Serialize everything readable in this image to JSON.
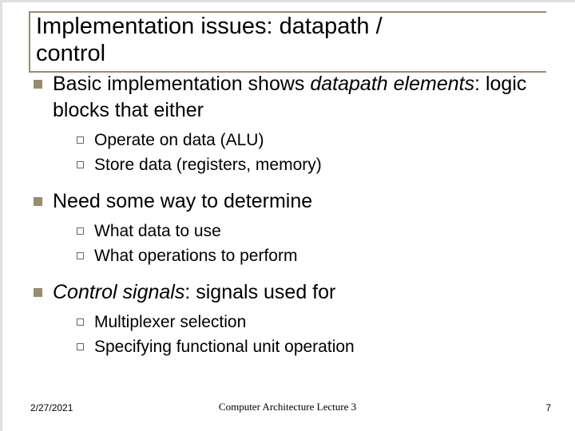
{
  "slide": {
    "title_line1": "Implementation issues: datapath /",
    "title_line2": "control",
    "bullets": [
      {
        "pre": "Basic implementation shows ",
        "em": "datapath elements",
        "post": ": logic blocks that either",
        "subs": [
          "Operate on data (ALU)",
          "Store data (registers, memory)"
        ]
      },
      {
        "pre": "Need some way to determine",
        "em": "",
        "post": "",
        "subs": [
          "What data to use",
          "What operations to perform"
        ]
      },
      {
        "pre": "",
        "em": "Control signals",
        "post": ": signals used for",
        "subs": [
          "Multiplexer selection",
          "Specifying functional unit operation"
        ]
      }
    ]
  },
  "footer": {
    "date": "2/27/2021",
    "center": "Computer Architecture Lecture 3",
    "page": "7"
  }
}
